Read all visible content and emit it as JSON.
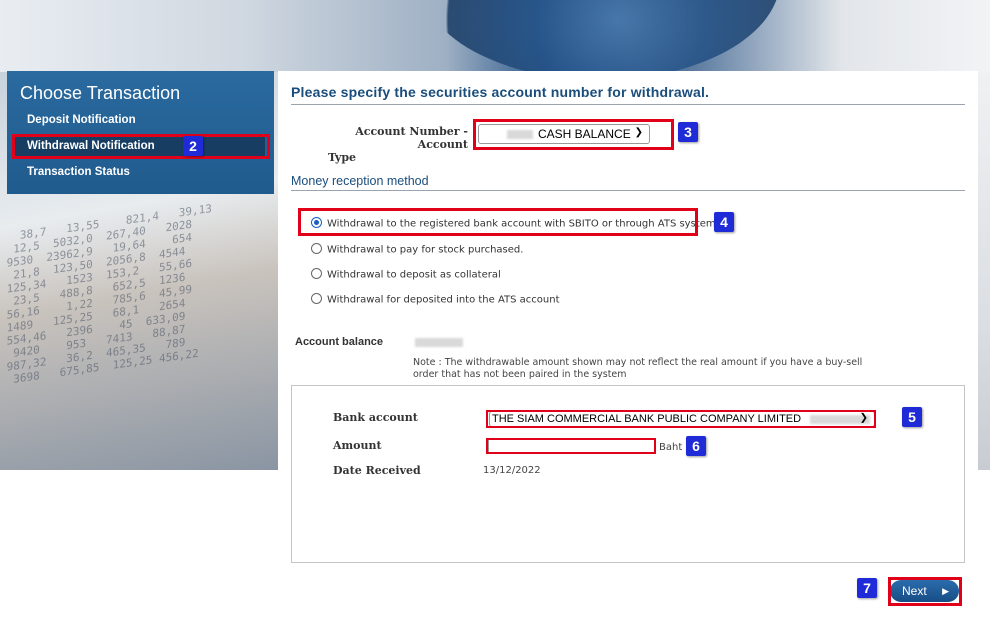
{
  "nav": {
    "title": "Choose Transaction",
    "items": [
      {
        "label": "Deposit Notification"
      },
      {
        "label": "Withdrawal Notification",
        "selected": true
      },
      {
        "label": "Transaction Status"
      }
    ]
  },
  "main": {
    "heading": "Please specify the securities account number for withdrawal.",
    "account_label": "Account Number - Account Type",
    "account_label_line1": "Account Number - Account",
    "account_label_line2": "Type",
    "account_select_value": "CASH BALANCE",
    "reception_heading": "Money reception method",
    "radio_options": [
      {
        "label": "Withdrawal to the registered bank account with SBITO or through ATS system.",
        "checked": true
      },
      {
        "label": "Withdrawal to pay for stock purchased.",
        "checked": false
      },
      {
        "label": "Withdrawal to deposit as collateral",
        "checked": false
      },
      {
        "label": "Withdrawal for deposited into the ATS account",
        "checked": false
      }
    ],
    "balance_label": "Account balance",
    "note_line1": "Note : The withdrawable amount shown may not reflect the real amount if you have a buy-sell",
    "note_line2": "order that has not been paired in the system",
    "bank_label": "Bank account",
    "bank_select_value": "THE SIAM COMMERCIAL BANK PUBLIC COMPANY LIMITED",
    "amount_label": "Amount",
    "amount_value": "",
    "amount_unit": "Baht",
    "date_label": "Date Received",
    "date_value": "13/12/2022",
    "next_label": "Next"
  },
  "badges": [
    "2",
    "3",
    "4",
    "5",
    "6",
    "7"
  ],
  "colors": {
    "highlight": "#e1001a",
    "badge": "#1e2bd6",
    "nav": "#205b8d",
    "heading": "#1a4d7c"
  }
}
